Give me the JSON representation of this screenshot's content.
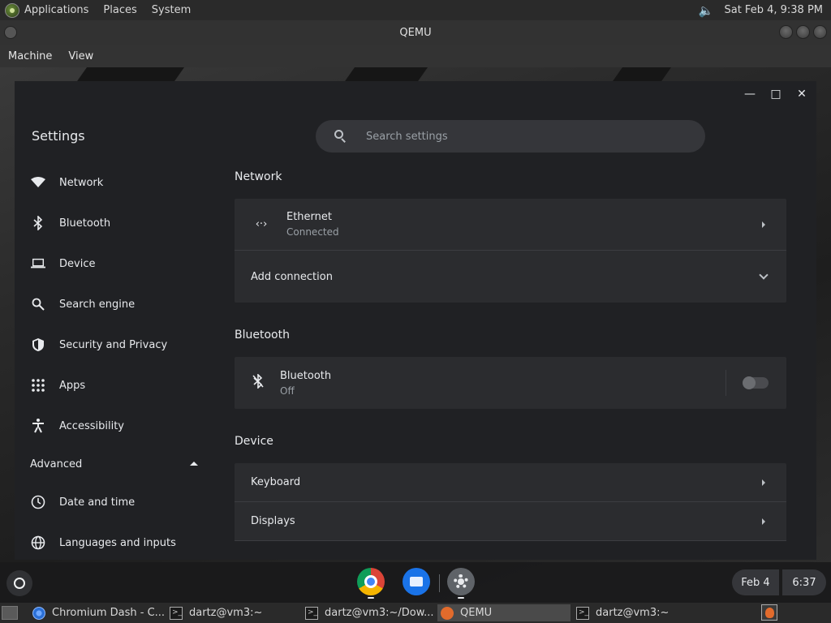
{
  "top_panel": {
    "menus": [
      "Applications",
      "Places",
      "System"
    ],
    "clock": "Sat Feb  4,  9:38 PM"
  },
  "qemu": {
    "title": "QEMU",
    "menu": [
      "Machine",
      "View"
    ]
  },
  "settings": {
    "title": "Settings",
    "search_placeholder": "Search settings",
    "nav": [
      {
        "label": "Network",
        "icon": "wifi-icon"
      },
      {
        "label": "Bluetooth",
        "icon": "bluetooth-icon"
      },
      {
        "label": "Device",
        "icon": "laptop-icon"
      },
      {
        "label": "Search engine",
        "icon": "search-icon"
      },
      {
        "label": "Security and Privacy",
        "icon": "shield-icon"
      },
      {
        "label": "Apps",
        "icon": "grid-icon"
      },
      {
        "label": "Accessibility",
        "icon": "accessibility-icon"
      }
    ],
    "advanced_label": "Advanced",
    "advanced_nav": [
      {
        "label": "Date and time",
        "icon": "clock-icon"
      },
      {
        "label": "Languages and inputs",
        "icon": "globe-icon"
      }
    ],
    "sections": {
      "network": {
        "title": "Network",
        "ethernet_label": "Ethernet",
        "ethernet_status": "Connected",
        "add_connection": "Add connection"
      },
      "bluetooth": {
        "title": "Bluetooth",
        "label": "Bluetooth",
        "status": "Off"
      },
      "device": {
        "title": "Device",
        "keyboard": "Keyboard",
        "displays": "Displays"
      }
    }
  },
  "shelf": {
    "date": "Feb 4",
    "time": "6:37"
  },
  "taskbar": {
    "items": [
      {
        "label": "Chromium Dash - C..."
      },
      {
        "label": "dartz@vm3:~"
      },
      {
        "label": "dartz@vm3:~/Dow..."
      },
      {
        "label": "QEMU"
      },
      {
        "label": "dartz@vm3:~"
      }
    ]
  }
}
